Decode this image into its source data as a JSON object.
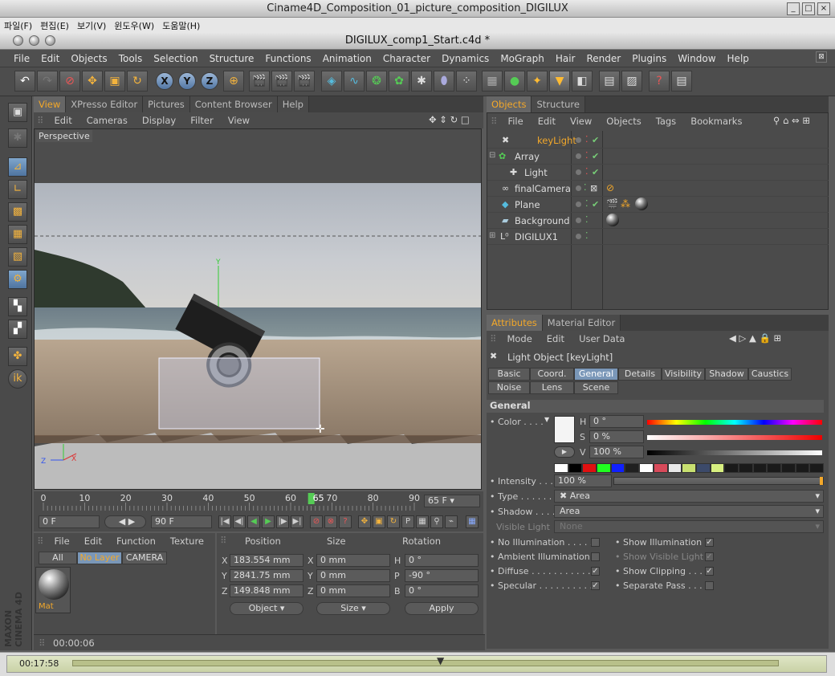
{
  "window": {
    "title": "Ciname4D_Composition_01_picture_composition_DIGILUX",
    "doc_title": "DIGILUX_comp1_Start.c4d *"
  },
  "outer_menu": [
    "파일(F)",
    "편집(E)",
    "보기(V)",
    "윈도우(W)",
    "도움말(H)"
  ],
  "main_menu": [
    "File",
    "Edit",
    "Objects",
    "Tools",
    "Selection",
    "Structure",
    "Functions",
    "Animation",
    "Character",
    "Dynamics",
    "MoGraph",
    "Hair",
    "Render",
    "Plugins",
    "Window",
    "Help"
  ],
  "view_tabs": [
    "View",
    "XPresso Editor",
    "Pictures",
    "Content Browser",
    "Help"
  ],
  "view_menu": [
    "Edit",
    "Cameras",
    "Display",
    "Filter",
    "View"
  ],
  "viewport": {
    "label": "Perspective",
    "axis_y": "Y",
    "axis_z": "Z",
    "axis_x": "X"
  },
  "timeline": {
    "ticks": [
      "0",
      "10",
      "20",
      "30",
      "40",
      "50",
      "60",
      "65",
      "70",
      "80",
      "90"
    ],
    "current_frame": 65,
    "end_field": "65 F"
  },
  "transport": {
    "start": "0 F",
    "end": "90 F"
  },
  "objects_tabs": [
    "Objects",
    "Structure"
  ],
  "objects_menu": [
    "File",
    "Edit",
    "View",
    "Objects",
    "Tags",
    "Bookmarks"
  ],
  "objects": [
    {
      "name": "keyLight",
      "selected": true
    },
    {
      "name": "Array",
      "selected": false
    },
    {
      "name": "Light",
      "selected": false
    },
    {
      "name": "finalCamera",
      "selected": false
    },
    {
      "name": "Plane",
      "selected": false
    },
    {
      "name": "Background",
      "selected": false
    },
    {
      "name": "DIGILUX1",
      "selected": false
    }
  ],
  "attr_tabs": [
    "Attributes",
    "Material Editor"
  ],
  "attr_menu": [
    "Mode",
    "Edit",
    "User Data"
  ],
  "attr_title": "Light Object [keyLight]",
  "attr_buttons_row1": [
    "Basic",
    "Coord.",
    "General",
    "Details",
    "Visibility",
    "Shadow",
    "Caustics"
  ],
  "attr_buttons_row2": [
    "Noise",
    "Lens",
    "Scene"
  ],
  "general": {
    "section": "General",
    "color_label": "Color . . . .",
    "h_label": "H",
    "h_value": "0 °",
    "s_label": "S",
    "s_value": "0 %",
    "v_label": "V",
    "v_value": "100 %",
    "intensity_label": "Intensity . . .",
    "intensity_value": "100 %",
    "type_label": "Type . . . . . .",
    "type_value": "Area",
    "shadow_label": "Shadow . . . .",
    "shadow_value": "Area",
    "visible_label": "Visible Light",
    "visible_value": "None",
    "checks": [
      {
        "label": "No Illumination . . . . .",
        "checked": false
      },
      {
        "label": "Show Illumination",
        "checked": true
      },
      {
        "label": "Ambient Illumination",
        "checked": false
      },
      {
        "label": "Show Visible Light",
        "checked": true
      },
      {
        "label": "Diffuse . . . . . . . . . . . .",
        "checked": true
      },
      {
        "label": "Show Clipping . . . . .",
        "checked": true
      },
      {
        "label": "Specular . . . . . . . . . .",
        "checked": true
      },
      {
        "label": "Separate Pass . . . .",
        "checked": false
      }
    ],
    "swatches": [
      "#ffffff",
      "#000000",
      "#e01010",
      "#20ff20",
      "#1020ff",
      "#202020",
      "#ffffff",
      "#d84a5a",
      "#e8e8e8",
      "#c8e070",
      "#3c4a6a",
      "#d8f080",
      "#1a1a1a",
      "#1a1a1a",
      "#1a1a1a",
      "#1a1a1a",
      "#1a1a1a",
      "#1a1a1a",
      "#1a1a1a"
    ]
  },
  "materials_menu": [
    "File",
    "Edit",
    "Function",
    "Texture"
  ],
  "materials_tabs": [
    "All",
    "No Layer",
    "CAMERA"
  ],
  "material": {
    "name": "Mat"
  },
  "coords": {
    "headers": [
      "Position",
      "Size",
      "Rotation"
    ],
    "rows": [
      {
        "axis": "X",
        "pos": "183.554 mm",
        "saxis": "X",
        "size": "0 mm",
        "raxis": "H",
        "rot": "0 °"
      },
      {
        "axis": "Y",
        "pos": "2841.75 mm",
        "saxis": "Y",
        "size": "0 mm",
        "raxis": "P",
        "rot": "-90 °"
      },
      {
        "axis": "Z",
        "pos": "149.848 mm",
        "saxis": "Z",
        "size": "0 mm",
        "raxis": "B",
        "rot": "0 °"
      }
    ],
    "mode": "Object",
    "size_mode": "Size",
    "apply": "Apply"
  },
  "status_time": "00:00:06",
  "player_time": "00:17:58",
  "logo": "MAXON CINEMA 4D"
}
